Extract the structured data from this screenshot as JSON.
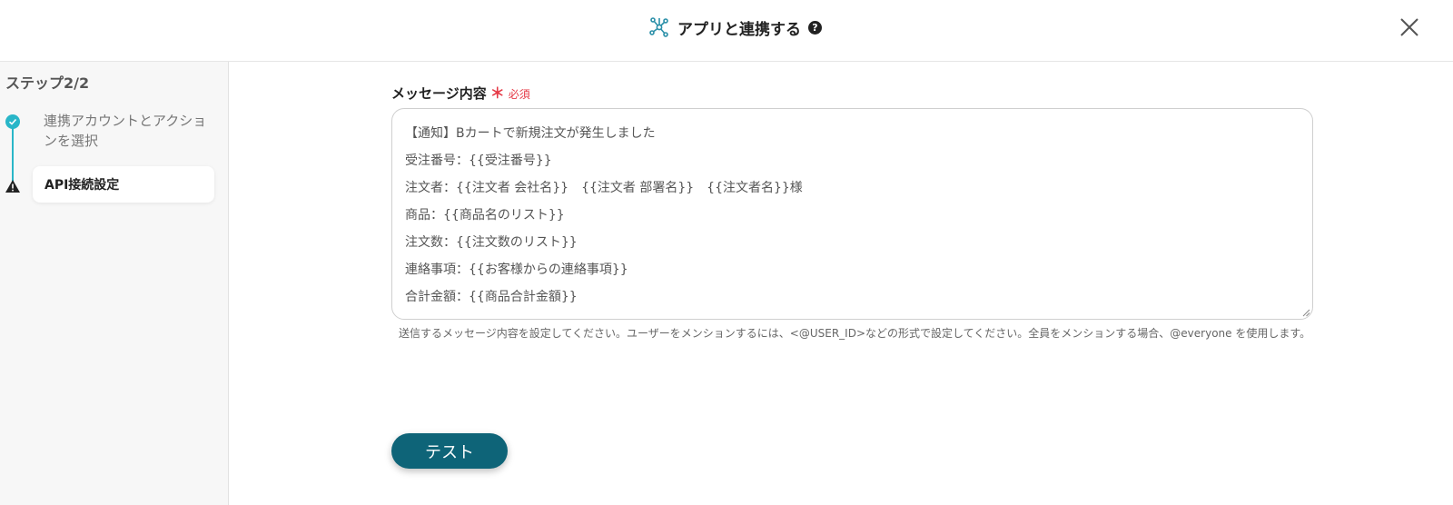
{
  "header": {
    "title": "アプリと連携する",
    "help_icon": "help-icon",
    "help_glyph": "?",
    "app_icon": "integration-icon",
    "close_icon": "close-icon"
  },
  "sidebar": {
    "step_heading": "ステップ2/2",
    "steps": [
      {
        "label": "連携アカウントとアクションを選択",
        "status": "completed",
        "icon": "check-icon"
      },
      {
        "label": "API接続設定",
        "status": "warning",
        "icon": "warning-icon"
      }
    ]
  },
  "form": {
    "message_label": "メッセージ内容",
    "required_star": "＊",
    "required_text": "必須",
    "message_lines": [
      "【通知】Bカートで新規注文が発生しました",
      "受注番号：{{受注番号}}",
      "注文者：{{注文者 会社名}}　{{注文者 部署名}}　{{注文者名}}様",
      "商品：{{商品名のリスト}}",
      "注文数：{{注文数のリスト}}",
      "連絡事項：{{お客様からの連絡事項}}",
      "合計金額：{{商品合計金額}}"
    ],
    "helper_text": "送信するメッセージ内容を設定してください。ユーザーをメンションするには、<@USER_ID>などの形式で設定してください。全員をメンションする場合、@everyone を使用します。",
    "test_button": "テスト"
  },
  "colors": {
    "accent": "#29b6c8",
    "button": "#0e6478",
    "required": "#e53946"
  }
}
